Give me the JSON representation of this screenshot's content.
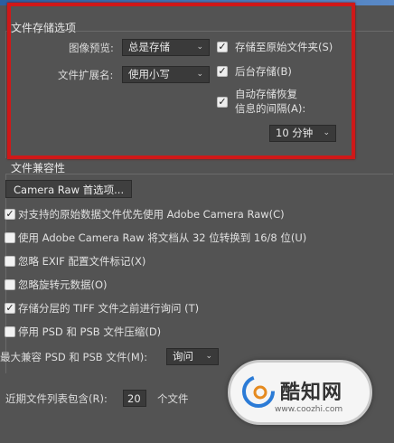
{
  "save_options": {
    "group_title": "文件存储选项",
    "image_preview_label": "图像预览:",
    "image_preview_value": "总是存储",
    "extension_label": "文件扩展名:",
    "extension_value": "使用小写",
    "save_to_original": {
      "label": "存储至原始文件夹(S)",
      "checked": true
    },
    "background_save": {
      "label": "后台存储(B)",
      "checked": true
    },
    "auto_save": {
      "label_line1": "自动存储恢复",
      "label_line2": "信息的间隔(A):",
      "checked": true
    },
    "interval_value": "10 分钟"
  },
  "compat": {
    "group_title": "文件兼容性",
    "camera_raw_button": "Camera Raw 首选项...",
    "options": [
      {
        "label": "对支持的原始数据文件优先使用 Adobe Camera Raw(C)",
        "checked": true
      },
      {
        "label": "使用 Adobe Camera Raw 将文档从 32 位转换到 16/8 位(U)",
        "checked": false
      },
      {
        "label": "忽略 EXIF 配置文件标记(X)",
        "checked": false
      },
      {
        "label": "忽略旋转元数据(O)",
        "checked": false
      },
      {
        "label": "存储分层的 TIFF 文件之前进行询问 (T)",
        "checked": true
      },
      {
        "label": "停用 PSD 和 PSB 文件压缩(D)",
        "checked": false
      }
    ],
    "max_compat_label": "最大兼容 PSD 和 PSB 文件(M):",
    "max_compat_value": "询问"
  },
  "recent": {
    "label": "近期文件列表包含(R):",
    "value": "20",
    "unit": "个文件"
  },
  "watermark": {
    "name": "酷知网",
    "url": "www.coozhi.com"
  },
  "accent_colors": {
    "highlight_box": "#d01818",
    "panel_bg": "#535353"
  }
}
